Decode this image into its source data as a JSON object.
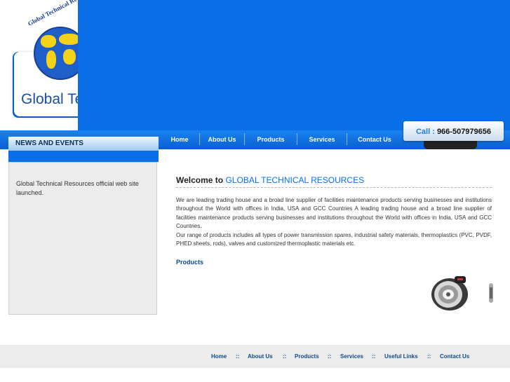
{
  "logo": {
    "arc_text": "Global Technical Re",
    "name": "Global Te"
  },
  "nav": {
    "items": [
      {
        "label": "Home"
      },
      {
        "label": "About Us"
      },
      {
        "label": "Products"
      },
      {
        "label": "Services"
      },
      {
        "label": "Contact Us"
      }
    ]
  },
  "call": {
    "label": "Call :",
    "number": "966-507979656"
  },
  "news": {
    "title": "NEWS AND EVENTS",
    "text": "Global Technical Resources official web site launched."
  },
  "main": {
    "welcome_prefix": "Welcome to",
    "welcome_brand": "GLOBAL TECHNICAL RESOURCES",
    "paragraph1": "We are leading trading house and a broad line supplier of facilities maintenance products serving businesses and institutions throughout the World with offices in India, USA and GCC Countries A leading trading house and a broad line supplier of facilities maintenance products serving businesses and institutions throughout the World with offices in India, USA and GCC Countries.",
    "paragraph2": "Our range of products includes all types of power transmission spares, industrial safety materials, thermoplastics (PVC, PVDF, PHED sheets, rods), valves and customized thermoplastic materials etc.",
    "products_link": "Products"
  },
  "footer": {
    "links": [
      "Home",
      "About Us",
      "Products",
      "Services",
      "Useful Links",
      "Contact Us"
    ],
    "separator": "::"
  },
  "colors": {
    "brand_blue": "#0a6fe6",
    "link_blue": "#0b4c8c",
    "globe_yellow": "#f5d21a"
  }
}
